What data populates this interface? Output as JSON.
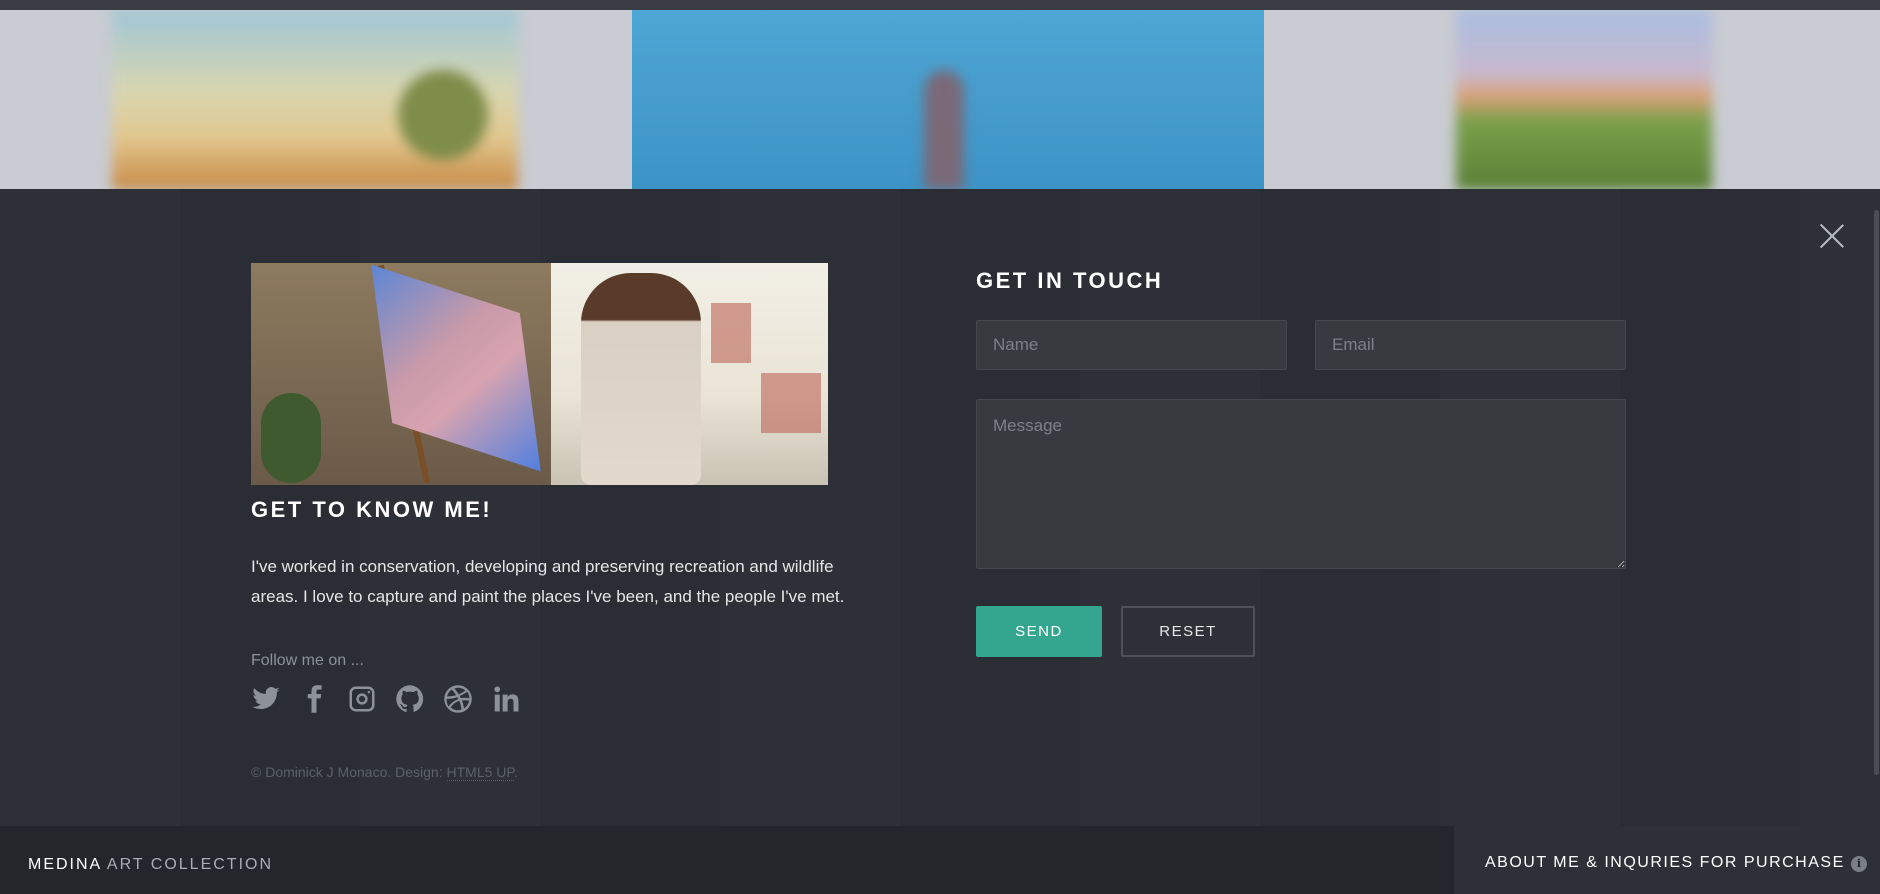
{
  "about": {
    "heading": "GET TO KNOW ME!",
    "bio": "I've worked in conservation, developing and preserving recreation and wildlife areas. I love to capture and paint the places I've been, and the people I've met.",
    "follow_label": "Follow me on ...",
    "socials": [
      {
        "icon": "twitter-icon"
      },
      {
        "icon": "facebook-icon"
      },
      {
        "icon": "instagram-icon"
      },
      {
        "icon": "github-icon"
      },
      {
        "icon": "dribbble-icon"
      },
      {
        "icon": "linkedin-icon"
      }
    ],
    "copyright": {
      "prefix": "© Dominick J Monaco. Design: ",
      "link": "HTML5 UP",
      "suffix": "."
    }
  },
  "contact": {
    "heading": "GET IN TOUCH",
    "name_placeholder": "Name",
    "email_placeholder": "Email",
    "message_placeholder": "Message",
    "send_label": "SEND",
    "reset_label": "RESET"
  },
  "footer": {
    "brand_first": "MEDINA",
    "brand_rest": " ART COLLECTION",
    "about_label": "ABOUT ME & INQURIES FOR PURCHASE",
    "info_icon": "i"
  },
  "colors": {
    "accent": "#34a58e",
    "panel": "#2b2e34",
    "footer": "#23262b"
  }
}
